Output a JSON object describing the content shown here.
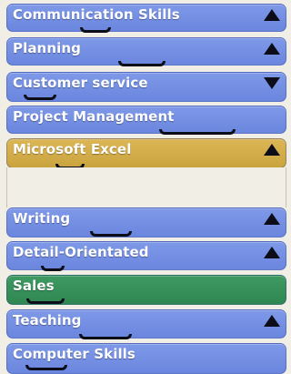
{
  "accordion": {
    "items": [
      {
        "label": "Communication Skills",
        "arrow": "up"
      },
      {
        "label": "Planning",
        "arrow": "up"
      },
      {
        "label": "Customer service",
        "arrow": "down"
      },
      {
        "label": "Project Management",
        "arrow": ""
      },
      {
        "label": "Microsoft Excel",
        "arrow": "up",
        "state": "expanded"
      },
      {
        "label": "Writing",
        "arrow": "up"
      },
      {
        "label": "Detail-Orientated",
        "arrow": "up"
      },
      {
        "label": "Sales",
        "arrow": "",
        "state": "selected"
      },
      {
        "label": "Teaching",
        "arrow": "up"
      },
      {
        "label": "Computer Skills",
        "arrow": ""
      }
    ]
  },
  "colors": {
    "item_blue": "#7590e4",
    "item_gold": "#d6b24f",
    "item_green": "#348c58",
    "arrow": "#0d0d1a",
    "panel_background": "#f1eee6"
  }
}
